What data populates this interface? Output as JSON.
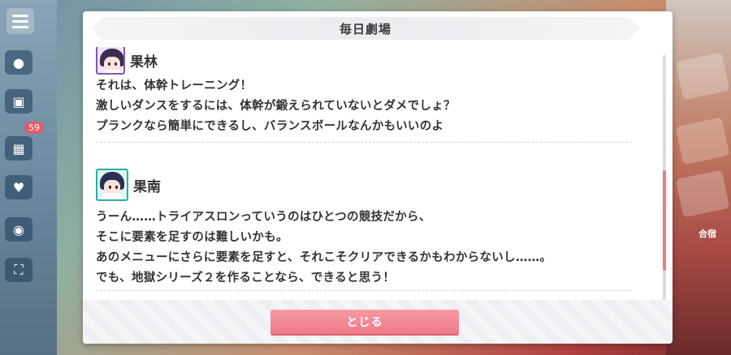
{
  "dialog": {
    "title": "毎日劇場",
    "close_label": "とじる"
  },
  "entries": [
    {
      "speaker": "果林",
      "avatar_icon": "avatar-karin-icon",
      "lines": [
        "それは、体幹トレーニング！",
        "激しいダンスをするには、体幹が鍛えられていないとダメでしょ？",
        "プランクなら簡単にできるし、バランスボールなんかもいいのよ"
      ]
    },
    {
      "speaker": "果南",
      "avatar_icon": "avatar-kanan-icon",
      "lines": [
        "うーん……トライアスロンっていうのはひとつの競技だから、",
        "そこに要素を足すのは難しいかも。",
        "あのメニューにさらに要素を足すと、それこそクリアできるかもわからないし……。",
        "でも、地獄シリーズ２を作ることなら、できると思う！"
      ]
    }
  ],
  "background": {
    "badge_count": "59",
    "right_label": "合宿"
  },
  "colors": {
    "accent": "#ef7b88",
    "karin": "#7a5ab8",
    "kanan": "#2aaea8"
  }
}
